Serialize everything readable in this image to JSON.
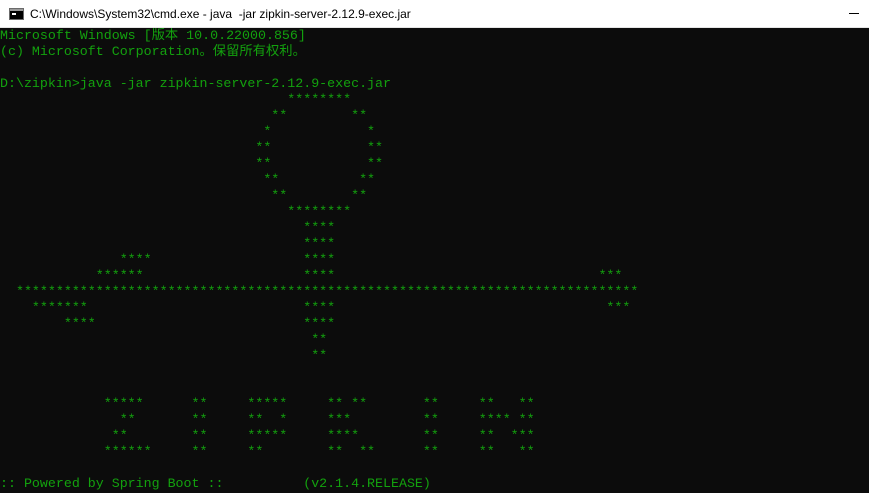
{
  "window": {
    "title": "C:\\Windows\\System32\\cmd.exe - java  -jar zipkin-server-2.12.9-exec.jar",
    "icon": "console-app-icon",
    "controls": [
      "minimize-icon"
    ]
  },
  "console": {
    "text_color": "#13a10e",
    "background": "#0c0c0c",
    "lines": [
      "Microsoft Windows [版本 10.0.22000.856]",
      "(c) Microsoft Corporation。保留所有权利。",
      "",
      "D:\\zipkin>java -jar zipkin-server-2.12.9-exec.jar",
      "                                    ********",
      "                                  **        **",
      "                                 *            *",
      "                                **            **",
      "                                **            **",
      "                                 **          **",
      "                                  **        **",
      "                                    ********",
      "                                      ****",
      "                                      ****",
      "               ****                   ****",
      "            ******                    ****                                 ***",
      "  ******************************************************************************",
      "    *******                           ****                                  ***",
      "        ****                          ****",
      "                                       **",
      "                                       **",
      "",
      "",
      "             *****      **     *****     ** **       **     **   **",
      "               **       **     **  *     ***         **     **** **",
      "              **        **     *****     ****        **     **  ***",
      "             ******     **     **        **  **      **     **   **",
      "",
      ":: Powered by Spring Boot ::          (v2.1.4.RELEASE)"
    ]
  }
}
